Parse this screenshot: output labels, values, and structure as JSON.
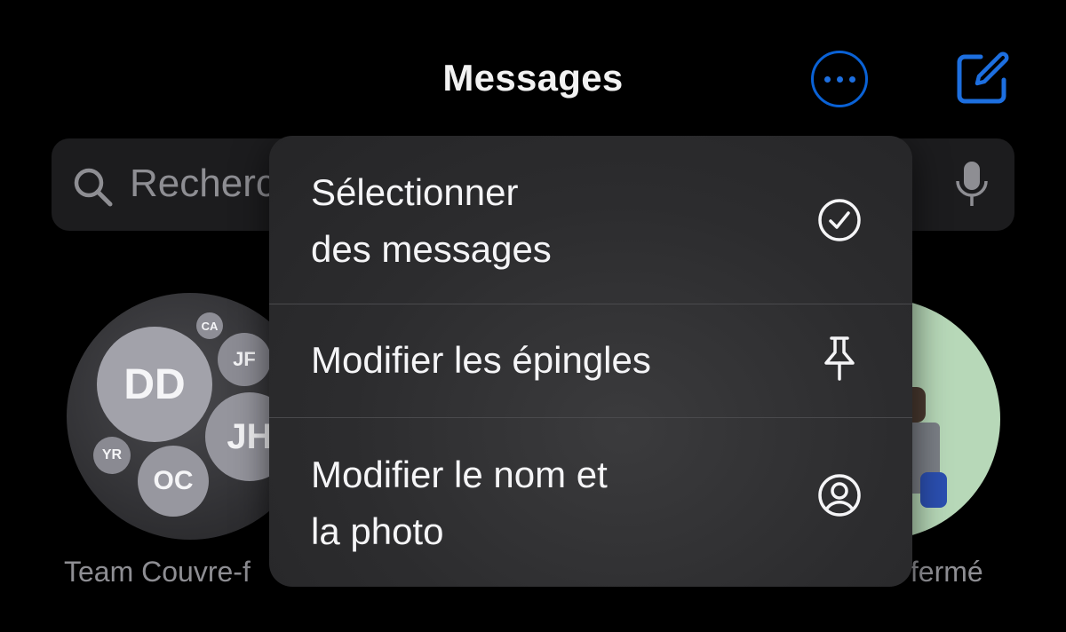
{
  "header": {
    "title": "Messages",
    "more_icon": "ellipsis-circle-icon",
    "compose_icon": "compose-icon",
    "accent_color": "#0a62d6"
  },
  "search": {
    "placeholder": "Recherc",
    "search_icon": "magnifier-icon",
    "mic_icon": "microphone-icon"
  },
  "pinned": [
    {
      "label": "Team Couvre-f",
      "initials": [
        "DD",
        "CA",
        "JF",
        "JH",
        "YR",
        "OC"
      ]
    },
    {
      "label": "s fermé"
    }
  ],
  "menu": {
    "items": [
      {
        "label": "Sélectionner\ndes messages",
        "icon": "checkmark-circle-icon"
      },
      {
        "label": "Modifier les épingles",
        "icon": "pin-icon"
      },
      {
        "label": "Modifier le nom et\nla photo",
        "icon": "person-circle-icon"
      }
    ]
  }
}
